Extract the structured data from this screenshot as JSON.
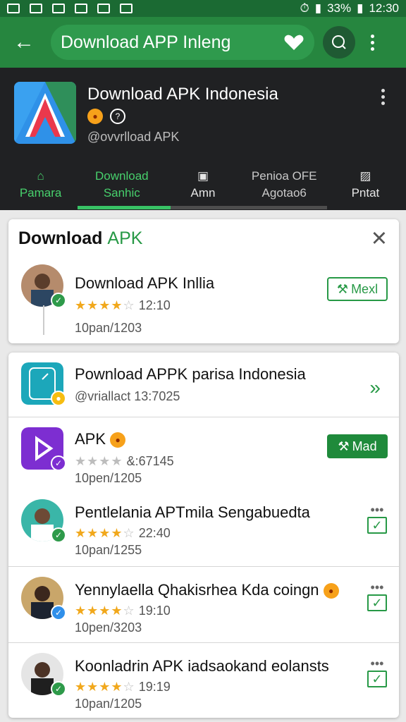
{
  "status_bar": {
    "battery": "33%",
    "time": "12:30"
  },
  "toolbar": {
    "search_value": "Download APP Inleng"
  },
  "app_header": {
    "title": "Download APK Indonesia",
    "subtitle": "@ovvrlload APK"
  },
  "tabs": [
    {
      "label": "Pamara",
      "active": false
    },
    {
      "label": "Download",
      "sublabel": "Sanhic",
      "active": true
    },
    {
      "label": "Amn",
      "active": false
    },
    {
      "label": "Penioa OFE",
      "sublabel": "Agotao6",
      "active": false
    },
    {
      "label": "Pntat",
      "active": false
    }
  ],
  "card1": {
    "title_prefix": "Download",
    "title_accent": "APK",
    "item": {
      "title": "Download APK Inllia",
      "rating": 4.5,
      "meta": "12:10",
      "date": "10pan/1203",
      "action": "Mexl"
    }
  },
  "card2": {
    "items": [
      {
        "title": "Pownload APPK parisa Indonesia",
        "meta": "@vriallact 13:7025"
      },
      {
        "title": "APK",
        "meta": "&:67145",
        "date": "10pen/1205",
        "action": "Mad"
      },
      {
        "title": "Pentlelania APTmila Sengabuedta",
        "rating": 4,
        "meta": "22:40",
        "date": "10pan/1255"
      },
      {
        "title": "Yennylaella Qhakisrhea Kda coingn",
        "rating": 4,
        "meta": "19:10",
        "date": "10pen/3203"
      },
      {
        "title": "Koonladrin APK iadsaokand eolansts",
        "rating": 4,
        "meta": "19:19",
        "date": "10pan/1205"
      }
    ]
  },
  "colors": {
    "primary": "#26863f",
    "accent": "#279946",
    "header_dark": "#202123"
  }
}
